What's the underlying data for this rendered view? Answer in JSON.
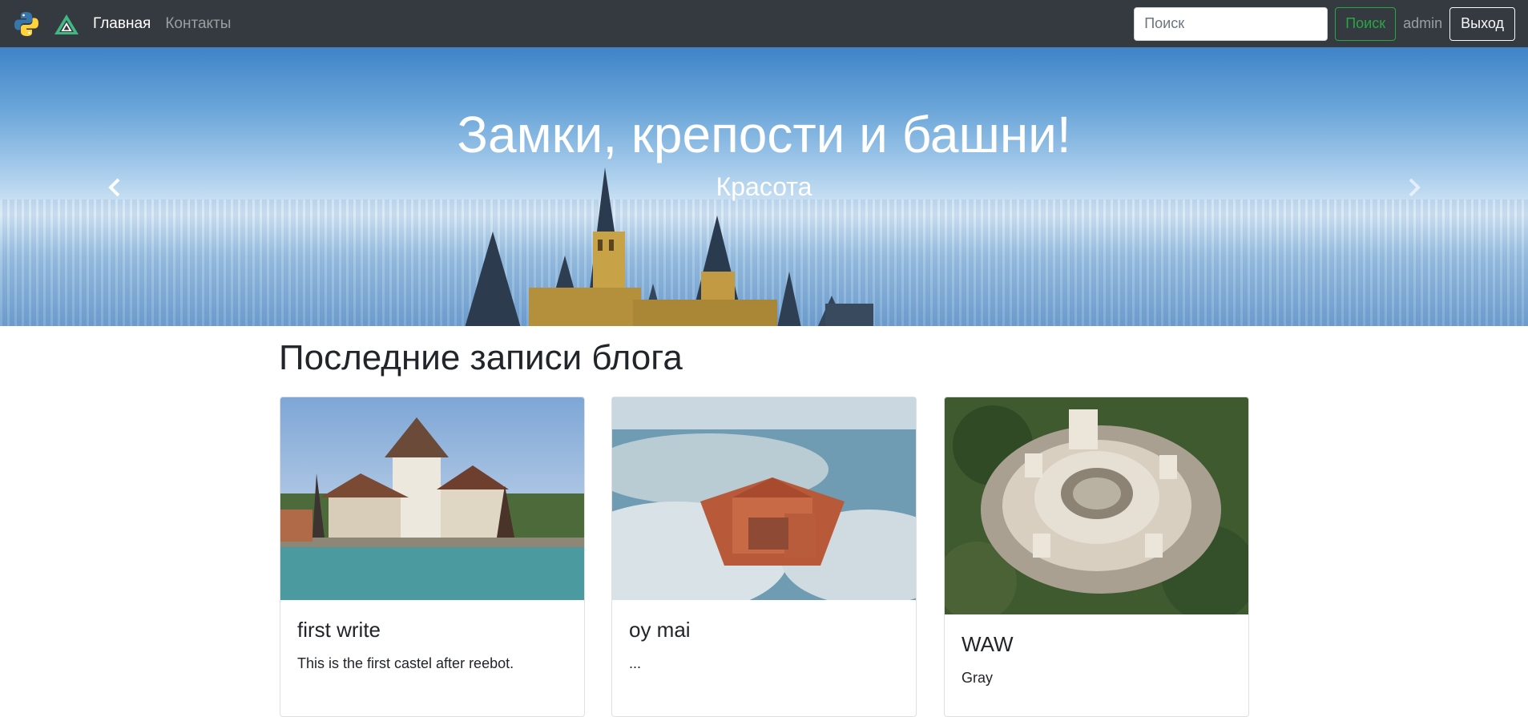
{
  "navbar": {
    "logos": [
      "python-logo-icon",
      "vue-logo-icon"
    ],
    "links": [
      {
        "label": "Главная",
        "active": true
      },
      {
        "label": "Контакты",
        "active": false
      }
    ],
    "search": {
      "placeholder": "Поиск",
      "value": "",
      "button_label": "Поиск"
    },
    "username": "admin",
    "logout_label": "Выход"
  },
  "carousel": {
    "title": "Замки, крепости и башни!",
    "subtitle": "Красота",
    "prev_icon": "chevron-left-icon",
    "next_icon": "chevron-right-icon"
  },
  "blog": {
    "heading": "Последние записи блога",
    "posts": [
      {
        "title": "first write",
        "text": "This is the first castel after reebot."
      },
      {
        "title": "oy mai",
        "text": "..."
      },
      {
        "title": "WAW",
        "text": "Gray"
      }
    ]
  },
  "colors": {
    "navbar_bg": "#343a40",
    "search_button": "#28a745",
    "text": "#212529"
  }
}
